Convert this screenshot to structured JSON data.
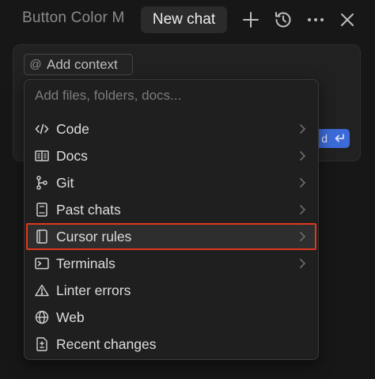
{
  "topbar": {
    "tab_title": "Button Color M",
    "active_tab": "New chat"
  },
  "composer": {
    "context_chip_label": "Add context",
    "send_partial": "d"
  },
  "menu": {
    "search_placeholder": "Add files, folders, docs...",
    "items": [
      {
        "label": "Code",
        "icon": "code-icon",
        "has_submenu": true
      },
      {
        "label": "Docs",
        "icon": "book-icon",
        "has_submenu": true
      },
      {
        "label": "Git",
        "icon": "git-branch-icon",
        "has_submenu": true
      },
      {
        "label": "Past chats",
        "icon": "notebook-icon",
        "has_submenu": true
      },
      {
        "label": "Cursor rules",
        "icon": "rules-file-icon",
        "has_submenu": true,
        "highlighted": true
      },
      {
        "label": "Terminals",
        "icon": "terminal-icon",
        "has_submenu": true
      },
      {
        "label": "Linter errors",
        "icon": "warning-icon",
        "has_submenu": false
      },
      {
        "label": "Web",
        "icon": "globe-icon",
        "has_submenu": false
      },
      {
        "label": "Recent changes",
        "icon": "file-diff-icon",
        "has_submenu": false
      }
    ]
  },
  "colors": {
    "background": "#171717",
    "accent_blue": "#3c6bd9",
    "highlight_outline": "#e0391f"
  }
}
